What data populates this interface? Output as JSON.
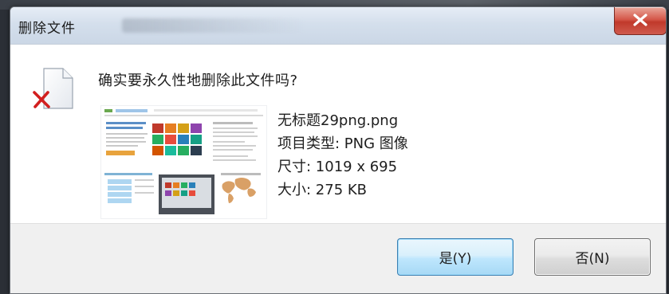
{
  "dialog": {
    "title": "删除文件",
    "question": "确实要永久性地删除此文件吗?",
    "close_label": "×"
  },
  "file": {
    "name": "无标题29png.png",
    "type_line": "项目类型: PNG 图像",
    "size_line": "尺寸: 1019 x 695",
    "bytes_line": "大小: 275 KB"
  },
  "buttons": {
    "yes": "是(Y)",
    "no": "否(N)"
  },
  "icons": {
    "file": "file-delete-icon",
    "close": "close-icon"
  },
  "colors": {
    "close_red": "#c0392b",
    "delete_x": "#d21f1f",
    "yes_border": "#3c7fb1"
  }
}
